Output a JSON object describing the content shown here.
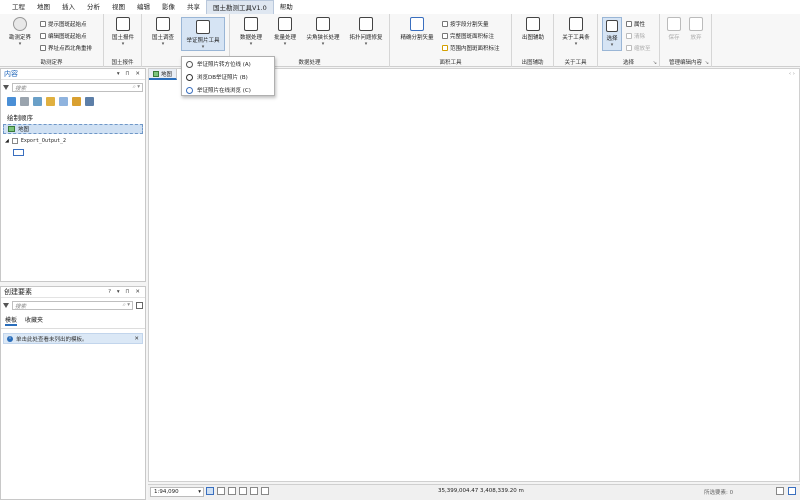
{
  "menubar": {
    "items": [
      "工程",
      "地图",
      "插入",
      "分析",
      "视图",
      "编辑",
      "影像",
      "共享",
      "国土勘测工具V1.0",
      "帮助"
    ],
    "active_index": 8
  },
  "ribbon": {
    "groups": [
      {
        "label": "勘测定界",
        "buttons": [
          "勘测定界"
        ],
        "small": [
          "提示图斑起始点",
          "编辑图斑起始点",
          "界址点西北角重排"
        ]
      },
      {
        "label": "国土报件",
        "buttons": [
          "国土报件"
        ]
      },
      {
        "label": "国土调查",
        "buttons": [
          "国土调查",
          "举证照片工具"
        ]
      },
      {
        "label": "数据处理",
        "buttons": [
          "数据处理",
          "批量处理",
          "尖角狭长处理",
          "拓扑问题修复"
        ]
      },
      {
        "label": "面积工具",
        "buttons": [
          "精确分割矢量"
        ],
        "small": [
          "按字段分割矢量",
          "完整图斑面积标注",
          "范围内图斑面积标注"
        ]
      },
      {
        "label": "出图辅助",
        "buttons": [
          "出图辅助"
        ]
      },
      {
        "label": "关于工具",
        "buttons": [
          "关于工具条"
        ]
      },
      {
        "label": "选择",
        "buttons": [
          "选择"
        ],
        "small": [
          "属性",
          "清除",
          "缩放至"
        ]
      },
      {
        "label": "管理编辑内容",
        "buttons": [
          "保存",
          "放弃"
        ]
      }
    ]
  },
  "dropdown": {
    "items": [
      "举证照片转方位线 (A)",
      "浏览DB举证照片 (B)",
      "举证照片在线浏览 (C)"
    ]
  },
  "contents_panel": {
    "title": "内容",
    "controls": "▾ ⊓ ✕",
    "search_placeholder": "搜索",
    "section": "绘制顺序",
    "map_node": "地图",
    "layer": "Export_Output_2"
  },
  "create_panel": {
    "title": "创建要素",
    "controls": "? ▾ ⊓ ✕",
    "search_placeholder": "搜索",
    "tabs": [
      "模板",
      "收藏夹"
    ],
    "info": "单击此处查看未列出的模板。"
  },
  "map": {
    "tab_label": "地图",
    "nav": "‹ ›"
  },
  "statusbar": {
    "scale": "1:94,090",
    "coordinates": "35,399,004.47 3,408,339.20 m",
    "selected": "所选要素: 0"
  },
  "colors": {
    "accent": "#2a6ebb",
    "title": "#1a62b8"
  }
}
